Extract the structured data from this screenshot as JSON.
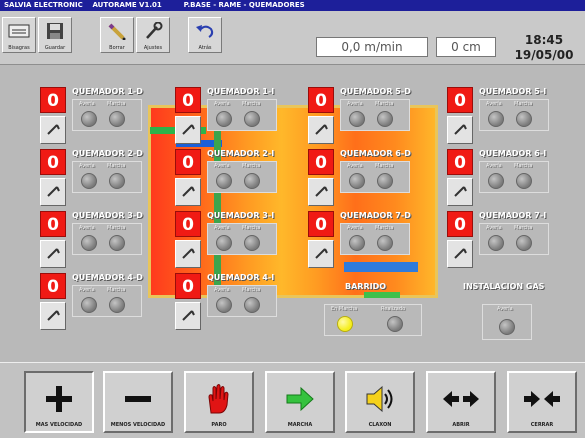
{
  "title": "SALVIA ELECTRONIC    AUTORAME V1.01         P.BASE - RAME - QUEMADORES",
  "toolbar": {
    "buttons": [
      {
        "label": "Bisagras",
        "icon": "display-icon"
      },
      {
        "label": "Guardar",
        "icon": "floppy-icon"
      },
      {
        "label": "Borrar",
        "icon": "pencil-icon"
      },
      {
        "label": "Ajustes",
        "icon": "wrench-icon"
      },
      {
        "label": "Atrás",
        "icon": "undo-icon"
      }
    ],
    "speed": "0,0 m/min",
    "distance": "0 cm",
    "time": "18:45",
    "date": "19/05/00"
  },
  "burners": [
    {
      "title": "QUEMADOR 1-D",
      "count": "0",
      "averia": "Avería",
      "marcha": "Marcha"
    },
    {
      "title": "QUEMADOR 2-D",
      "count": "0",
      "averia": "Avería",
      "marcha": "Marcha"
    },
    {
      "title": "QUEMADOR 3-D",
      "count": "0",
      "averia": "Avería",
      "marcha": "Marcha"
    },
    {
      "title": "QUEMADOR 4-D",
      "count": "0",
      "averia": "Avería",
      "marcha": "Marcha"
    },
    {
      "title": "QUEMADOR 1-I",
      "count": "0",
      "averia": "Avería",
      "marcha": "Marcha"
    },
    {
      "title": "QUEMADOR 2-I",
      "count": "0",
      "averia": "Avería",
      "marcha": "Marcha"
    },
    {
      "title": "QUEMADOR 3-I",
      "count": "0",
      "averia": "Avería",
      "marcha": "Marcha"
    },
    {
      "title": "QUEMADOR 4-I",
      "count": "0",
      "averia": "Avería",
      "marcha": "Marcha"
    },
    {
      "title": "QUEMADOR 5-D",
      "count": "0",
      "averia": "Avería",
      "marcha": "Marcha"
    },
    {
      "title": "QUEMADOR 6-D",
      "count": "0",
      "averia": "Avería",
      "marcha": "Marcha"
    },
    {
      "title": "QUEMADOR 7-D",
      "count": "0",
      "averia": "Avería",
      "marcha": "Marcha"
    },
    {
      "title": "QUEMADOR 5-I",
      "count": "0",
      "averia": "Avería",
      "marcha": "Marcha"
    },
    {
      "title": "QUEMADOR 6-I",
      "count": "0",
      "averia": "Avería",
      "marcha": "Marcha"
    },
    {
      "title": "QUEMADOR 7-I",
      "count": "0",
      "averia": "Avería",
      "marcha": "Marcha"
    }
  ],
  "barrido": {
    "title": "BARRIDO",
    "en_marcha": "En Marcha",
    "realizado": "Realizado"
  },
  "instalacion": {
    "title": "INSTALACION GAS",
    "averia": "Avería"
  },
  "colors": {
    "lamp_on": "#f5ee1c",
    "alarm_red": "#f01a14",
    "title_blue": "#1d1f9a"
  },
  "bottom": {
    "buttons": [
      {
        "label": "MAS VELOCIDAD",
        "icon": "plus-icon"
      },
      {
        "label": "MENOS VELOCIDAD",
        "icon": "minus-icon"
      },
      {
        "label": "PARO",
        "icon": "stop-hand-icon"
      },
      {
        "label": "MARCHA",
        "icon": "arrow-right-icon"
      },
      {
        "label": "CLAXON",
        "icon": "speaker-icon"
      },
      {
        "label": "ABRIR",
        "icon": "open-arrows-icon"
      },
      {
        "label": "CERRAR",
        "icon": "close-arrows-icon"
      }
    ]
  }
}
